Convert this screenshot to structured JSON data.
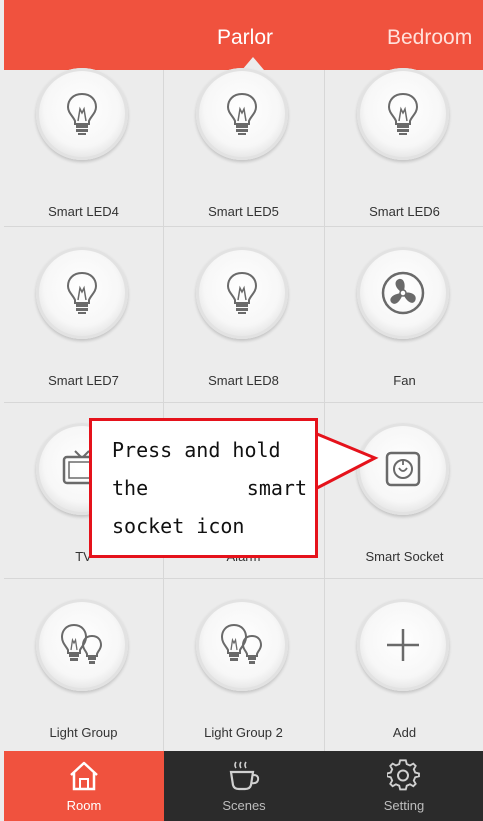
{
  "header": {
    "tabs": [
      {
        "label": "Parlor",
        "active": true
      },
      {
        "label": "Bedroom",
        "active": false
      }
    ],
    "background": "#f0523e"
  },
  "devices": [
    {
      "label": "Smart LED4",
      "icon": "bulb-icon"
    },
    {
      "label": "Smart LED5",
      "icon": "bulb-icon"
    },
    {
      "label": "Smart LED6",
      "icon": "bulb-icon"
    },
    {
      "label": "Smart LED7",
      "icon": "bulb-icon"
    },
    {
      "label": "Smart LED8",
      "icon": "bulb-icon"
    },
    {
      "label": "Fan",
      "icon": "fan-icon"
    },
    {
      "label": "TV",
      "icon": "tv-icon"
    },
    {
      "label": "Alarm",
      "icon": "alarm-icon"
    },
    {
      "label": "Smart Socket",
      "icon": "socket-icon"
    },
    {
      "label": "Light Group",
      "icon": "light-group-icon"
    },
    {
      "label": "Light Group 2",
      "icon": "light-group-icon"
    },
    {
      "label": "Add",
      "icon": "plus-icon"
    }
  ],
  "callout": {
    "line1": "Press and hold",
    "line2a": "the",
    "line2b": "smart",
    "line3": "socket icon",
    "border_color": "#e5121b"
  },
  "bottom_nav": [
    {
      "label": "Room",
      "icon": "home-icon",
      "active": true
    },
    {
      "label": "Scenes",
      "icon": "coffee-cup-icon",
      "active": false
    },
    {
      "label": "Setting",
      "icon": "gear-icon",
      "active": false
    }
  ]
}
